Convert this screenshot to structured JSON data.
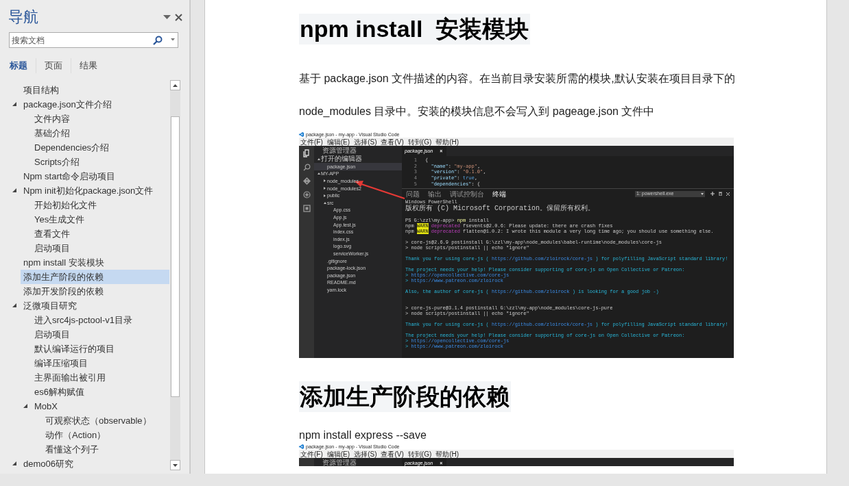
{
  "nav": {
    "title": "导航",
    "search": {
      "placeholder": "搜索文档"
    },
    "tabs": [
      {
        "label": "标题",
        "selected": true
      },
      {
        "label": "页面",
        "selected": false
      },
      {
        "label": "结果",
        "selected": false
      }
    ],
    "tree": [
      {
        "label": "项目结构",
        "selected": false
      },
      {
        "label": "package.json文件介绍",
        "selected": false,
        "expanded": true,
        "children": [
          {
            "label": "文件内容",
            "selected": false
          },
          {
            "label": "基础介绍",
            "selected": false
          },
          {
            "label": "Dependencies介绍",
            "selected": false
          },
          {
            "label": "Scripts介绍",
            "selected": false
          }
        ]
      },
      {
        "label": "Npm start命令启动项目",
        "selected": false
      },
      {
        "label": "Npm init初始化package.json文件",
        "selected": false,
        "expanded": true,
        "children": [
          {
            "label": "开始初始化文件",
            "selected": false
          },
          {
            "label": "Yes生成文件",
            "selected": false
          },
          {
            "label": "查看文件",
            "selected": false
          },
          {
            "label": "启动项目",
            "selected": false
          }
        ]
      },
      {
        "label": "npm install 安装模块",
        "selected": false
      },
      {
        "label": "添加生产阶段的依赖",
        "selected": true
      },
      {
        "label": "添加开发阶段的依赖",
        "selected": false
      },
      {
        "label": "泛微项目研究",
        "selected": false,
        "expanded": true,
        "children": [
          {
            "label": "进入src4js-pctool-v1目录",
            "selected": false
          },
          {
            "label": "启动项目",
            "selected": false
          },
          {
            "label": "默认编译运行的项目",
            "selected": false
          },
          {
            "label": "编译压缩项目",
            "selected": false
          },
          {
            "label": "主界面输出被引用",
            "selected": false
          },
          {
            "label": "es6解构赋值",
            "selected": false
          },
          {
            "label": "MobX",
            "selected": false,
            "expanded": true,
            "children": [
              {
                "label": "可观察状态（observable）",
                "selected": false
              },
              {
                "label": "动作（Action）",
                "selected": false
              },
              {
                "label": "看懂这个列子",
                "selected": false
              }
            ]
          }
        ]
      },
      {
        "label": "demo06研究",
        "selected": false,
        "expanded": true
      }
    ]
  },
  "document": {
    "blocks": [
      {
        "kind": "heading",
        "text": "npm install  安装模块"
      },
      {
        "kind": "paragraph",
        "text": "基于 package.json 文件描述的内容。在当前目录安装所需的模块,默认安装在项目目录下的node_modules 目录中。安装的模块信息不会写入到 pageage.json 文件中"
      },
      {
        "kind": "screenshot",
        "title": "package.json - my-app - Visual Studio Code",
        "menu": [
          "文件(F)",
          "编辑(E)",
          "选择(S)",
          "查看(V)",
          "转到(G)",
          "帮助(H)"
        ],
        "explorer": {
          "title": "资源管理器",
          "tree": [
            {
              "label": "打开的编辑器",
              "expanded": true,
              "children": [
                {
                  "label": "package.json",
                  "selected": true
                }
              ]
            },
            {
              "label": "MY-APP",
              "expanded": true,
              "children": [
                {
                  "label": "node_modules",
                  "expanded": false
                },
                {
                  "label": "node_modules2",
                  "expanded": false
                },
                {
                  "label": "public",
                  "expanded": false
                },
                {
                  "label": "src",
                  "expanded": true,
                  "children": [
                    {
                      "label": "App.css"
                    },
                    {
                      "label": "App.js"
                    },
                    {
                      "label": "App.test.js"
                    },
                    {
                      "label": "index.css"
                    },
                    {
                      "label": "index.js"
                    },
                    {
                      "label": "logo.svg"
                    },
                    {
                      "label": "serviceWorker.js"
                    }
                  ]
                },
                {
                  "label": ".gitignore"
                },
                {
                  "label": "package-lock.json"
                },
                {
                  "label": "package.json"
                },
                {
                  "label": "README.md"
                },
                {
                  "label": "yarn.lock"
                }
              ]
            }
          ]
        },
        "editor": {
          "tab": "package.json",
          "close": "×",
          "lines": [
            {
              "number": "1",
              "segments": [
                {
                  "kind": "punct",
                  "text": "{"
                }
              ]
            },
            {
              "number": "2",
              "segments": [
                {
                  "kind": "key",
                  "text": "  \"name\""
                },
                {
                  "kind": "punct",
                  "text": ": "
                },
                {
                  "kind": "string",
                  "text": "\"my-app\""
                },
                {
                  "kind": "punct",
                  "text": ","
                }
              ]
            },
            {
              "number": "3",
              "segments": [
                {
                  "kind": "key",
                  "text": "  \"version\""
                },
                {
                  "kind": "punct",
                  "text": ": "
                },
                {
                  "kind": "string",
                  "text": "\"0.1.0\""
                },
                {
                  "kind": "punct",
                  "text": ","
                }
              ]
            },
            {
              "number": "4",
              "segments": [
                {
                  "kind": "key",
                  "text": "  \"private\""
                },
                {
                  "kind": "punct",
                  "text": ": "
                },
                {
                  "kind": "bool",
                  "text": "true"
                },
                {
                  "kind": "punct",
                  "text": ","
                }
              ]
            },
            {
              "number": "5",
              "segments": [
                {
                  "kind": "key",
                  "text": "  \"dependencies\""
                },
                {
                  "kind": "punct",
                  "text": ": {"
                }
              ]
            }
          ]
        },
        "panel": {
          "tabs": [
            {
              "label": "问题",
              "selected": false
            },
            {
              "label": "输出",
              "selected": false
            },
            {
              "label": "调试控制台",
              "selected": false
            },
            {
              "label": "终端",
              "selected": true
            }
          ],
          "terminal_select": "1: powershell.exe",
          "lines": [
            {
              "kind": "line",
              "segments": [
                {
                  "kind": "plain",
                  "text": "Windows PowerShell"
                }
              ]
            },
            {
              "kind": "line",
              "segments": [
                {
                  "kind": "plain",
                  "text": "版权所有 (C) Microsoft Corporation。保留所有权利。"
                }
              ]
            },
            {
              "kind": "blank"
            },
            {
              "kind": "line",
              "segments": [
                {
                  "kind": "plain",
                  "text": "PS G:\\zzl\\my-app> "
                },
                {
                  "kind": "command",
                  "text": "npm"
                },
                {
                  "kind": "plain",
                  "text": " install"
                }
              ]
            },
            {
              "kind": "line",
              "segments": [
                {
                  "kind": "plain",
                  "text": "npm "
                },
                {
                  "kind": "warn",
                  "text": "WARN"
                },
                {
                  "kind": "deprecated",
                  "text": " deprecated"
                },
                {
                  "kind": "plain",
                  "text": " fsevents@2.0.6: Please update: there are crash fixes"
                }
              ]
            },
            {
              "kind": "line",
              "segments": [
                {
                  "kind": "plain",
                  "text": "npm "
                },
                {
                  "kind": "warn",
                  "text": "WARN"
                },
                {
                  "kind": "deprecated",
                  "text": " deprecated"
                },
                {
                  "kind": "plain",
                  "text": " flatten@1.0.2: I wrote this module a very long time ago; you should use something else."
                }
              ]
            },
            {
              "kind": "blank"
            },
            {
              "kind": "line",
              "segments": [
                {
                  "kind": "plain",
                  "text": "> core-js@2.6.9 postinstall G:\\zzl\\my-app\\node_modules\\babel-runtime\\node_modules\\core-js"
                }
              ]
            },
            {
              "kind": "line",
              "segments": [
                {
                  "kind": "plain",
                  "text": "> node scripts/postinstall || echo \"ignore\""
                }
              ]
            },
            {
              "kind": "blank"
            },
            {
              "kind": "line",
              "segments": [
                {
                  "kind": "info",
                  "text": "Thank you for using core-js ( "
                },
                {
                  "kind": "link",
                  "text": "https://github.com/zloirock/core-js"
                },
                {
                  "kind": "info",
                  "text": " ) for polyfilling JavaScript standard library!"
                }
              ]
            },
            {
              "kind": "blank"
            },
            {
              "kind": "line",
              "segments": [
                {
                  "kind": "info",
                  "text": "The project needs your help! Please consider supporting of core-js on Open Collective or Patreon:"
                }
              ]
            },
            {
              "kind": "line",
              "segments": [
                {
                  "kind": "info",
                  "text": "> "
                },
                {
                  "kind": "link",
                  "text": "https://opencollective.com/core-js"
                }
              ]
            },
            {
              "kind": "line",
              "segments": [
                {
                  "kind": "info",
                  "text": "> "
                },
                {
                  "kind": "link",
                  "text": "https://www.patreon.com/zloirock"
                }
              ]
            },
            {
              "kind": "blank"
            },
            {
              "kind": "line",
              "segments": [
                {
                  "kind": "info",
                  "text": "Also, the author of core-js ( "
                },
                {
                  "kind": "link",
                  "text": "https://github.com/zloirock"
                },
                {
                  "kind": "info",
                  "text": " ) is looking for a good job -)"
                }
              ]
            },
            {
              "kind": "blank"
            },
            {
              "kind": "blank"
            },
            {
              "kind": "line",
              "segments": [
                {
                  "kind": "plain",
                  "text": "> core-js-pure@3.1.4 postinstall G:\\zzl\\my-app\\node_modules\\core-js-pure"
                }
              ]
            },
            {
              "kind": "line",
              "segments": [
                {
                  "kind": "plain",
                  "text": "> node scripts/postinstall || echo \"ignore\""
                }
              ]
            },
            {
              "kind": "blank"
            },
            {
              "kind": "line",
              "segments": [
                {
                  "kind": "info",
                  "text": "Thank you for using core-js ( "
                },
                {
                  "kind": "link",
                  "text": "https://github.com/zloirock/core-js"
                },
                {
                  "kind": "info",
                  "text": " ) for polyfilling JavaScript standard library!"
                }
              ]
            },
            {
              "kind": "blank"
            },
            {
              "kind": "line",
              "segments": [
                {
                  "kind": "info",
                  "text": "The project needs your help! Please consider supporting of core-js on Open Collective or Patreon:"
                }
              ]
            },
            {
              "kind": "line",
              "segments": [
                {
                  "kind": "info",
                  "text": "> "
                },
                {
                  "kind": "link",
                  "text": "https://opencollective.com/core-js"
                }
              ]
            },
            {
              "kind": "line",
              "segments": [
                {
                  "kind": "info",
                  "text": "> "
                },
                {
                  "kind": "link",
                  "text": "https://www.patreon.com/zloirock"
                }
              ]
            }
          ]
        }
      },
      {
        "kind": "heading",
        "text": "添加生产阶段的依赖"
      },
      {
        "kind": "paragraph",
        "text": "npm install express --save"
      },
      {
        "kind": "screenshot",
        "title": "package.json - my-app - Visual Studio Code",
        "menu": [
          "文件(F)",
          "编辑(E)",
          "选择(S)",
          "查看(V)",
          "转到(G)",
          "帮助(H)"
        ],
        "explorer": {
          "title": "资源管理器"
        },
        "editor": {
          "tab": "package.json",
          "close": "×"
        }
      }
    ]
  }
}
